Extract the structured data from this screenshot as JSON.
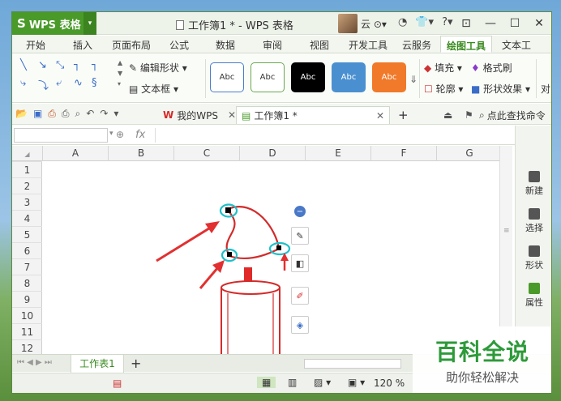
{
  "app": {
    "logo_label": "WPS 表格",
    "window_title": "工作簿1 * - WPS 表格",
    "user_name": "云"
  },
  "ribbon_tabs": [
    "开始",
    "插入",
    "页面布局",
    "公式",
    "数据",
    "审阅",
    "视图",
    "开发工具",
    "云服务",
    "绘图工具",
    "文本工"
  ],
  "active_tab": "绘图工具",
  "ribbon": {
    "edit_shape": "编辑形状",
    "text_box": "文本框",
    "style_samples": [
      {
        "label": "Abc",
        "bg": "#ffffff",
        "border": "#4a7bd0",
        "color": "#333333"
      },
      {
        "label": "Abc",
        "bg": "#ffffff",
        "border": "#6aa84f",
        "color": "#333333"
      },
      {
        "label": "Abc",
        "bg": "#000000",
        "border": "#000000",
        "color": "#ffffff"
      },
      {
        "label": "Abc",
        "bg": "#4a90d0",
        "border": "#4a90d0",
        "color": "#ffffff"
      },
      {
        "label": "Abc",
        "bg": "#f07a2a",
        "border": "#f07a2a",
        "color": "#ffffff"
      }
    ],
    "fill": "填充",
    "format_painter": "格式刷",
    "outline": "轮廓",
    "shape_effects": "形状效果",
    "more": "对"
  },
  "doc_tabs": {
    "mywps": "我的WPS",
    "workbook": "工作簿1 *",
    "search": "点此查找命令"
  },
  "formula_bar": {
    "fx": "fx"
  },
  "columns": [
    "A",
    "B",
    "C",
    "D",
    "E",
    "F",
    "G"
  ],
  "rows": [
    "1",
    "2",
    "3",
    "4",
    "5",
    "6",
    "7",
    "8",
    "9",
    "10",
    "11",
    "12"
  ],
  "right_panel": [
    "新建",
    "选择",
    "形状",
    "属性"
  ],
  "sheet_tab": "工作表1",
  "status": {
    "zoom": "120 %"
  },
  "watermark": {
    "title": "百科全说",
    "subtitle": "助你轻松解决"
  },
  "colors": {
    "accent": "#4a9a2a",
    "shape_red": "#d42a2a",
    "handle_cyan": "#20c0c8",
    "arrow_red": "#e23030"
  }
}
